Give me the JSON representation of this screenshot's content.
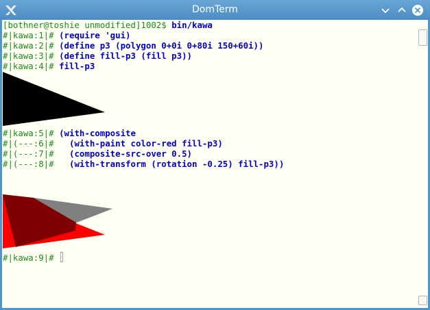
{
  "window": {
    "title": "DomTerm",
    "icons": {
      "app": "x-logo-icon",
      "minimize": "minimize-icon",
      "maximize": "maximize-icon",
      "close": "close-icon"
    }
  },
  "colors": {
    "prompt": "#1c8a1c",
    "input": "#0000c8",
    "background": "#fffef3",
    "titlebar": "#4f95c8"
  },
  "terminal": {
    "lines": [
      {
        "prompt": "[bothner@toshie unmodified]1002$ ",
        "input": "bin/kawa"
      },
      {
        "prompt": "#|kawa:1|# ",
        "input": "(require 'gui)"
      },
      {
        "prompt": "#|kawa:2|# ",
        "input": "(define p3 (polygon 0+0i 0+80i 150+60i))"
      },
      {
        "prompt": "#|kawa:3|# ",
        "input": "(define fill-p3 (fill p3))"
      },
      {
        "prompt": "#|kawa:4|# ",
        "input": "fill-p3"
      },
      {
        "prompt": "#|kawa:5|# ",
        "input": "(with-composite"
      },
      {
        "prompt": "#|(---:6|# ",
        "input": "  (with-paint color-red fill-p3)"
      },
      {
        "prompt": "#|(---:7|# ",
        "input": "  (composite-src-over 0.5)"
      },
      {
        "prompt": "#|(---:8|# ",
        "input": "  (with-transform (rotation -0.25) fill-p3))"
      },
      {
        "prompt": "#|kawa:9|# ",
        "input": ""
      }
    ],
    "figures": {
      "black_triangle": {
        "fill": "#000000"
      },
      "composite": {
        "red": "#ff0000",
        "gray": "#808080",
        "dark_overlap": "#7f0000"
      }
    }
  }
}
